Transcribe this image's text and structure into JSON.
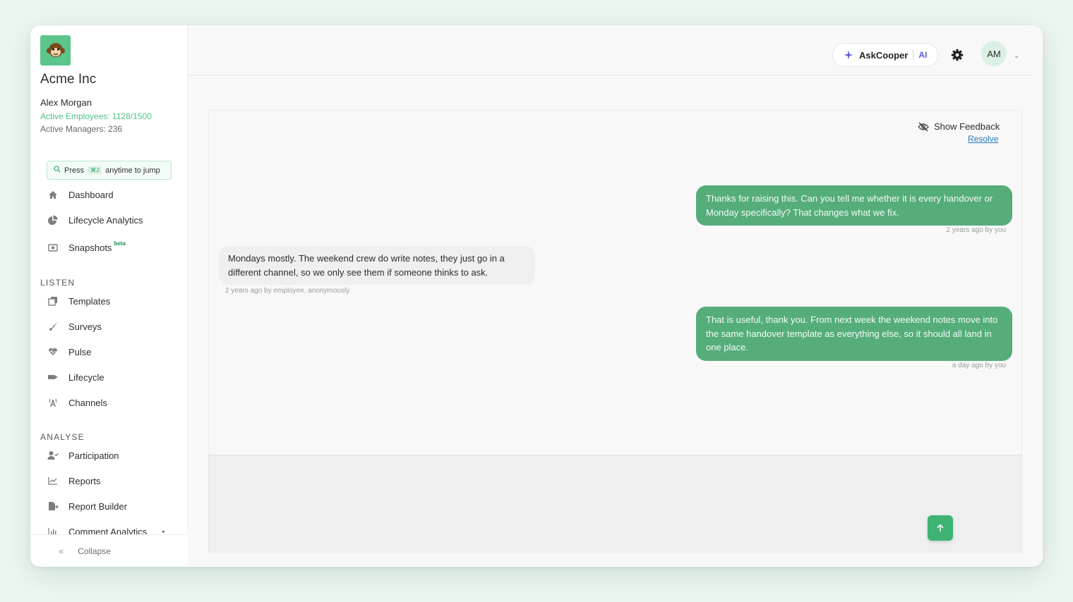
{
  "org": {
    "name": "Acme Inc",
    "user": "Alex Morgan",
    "active_employees": "Active Employees: 1128/1500",
    "active_managers": "Active Managers: 236"
  },
  "jump": {
    "press": "Press",
    "shortcut": "⌘J",
    "suffix": "anytime to jump"
  },
  "nav": {
    "dashboard": "Dashboard",
    "lifecycle_analytics": "Lifecycle Analytics",
    "snapshots": "Snapshots",
    "beta": "beta",
    "listen_label": "LISTEN",
    "templates": "Templates",
    "surveys": "Surveys",
    "pulse": "Pulse",
    "lifecycle": "Lifecycle",
    "channels": "Channels",
    "analyse_label": "ANALYSE",
    "participation": "Participation",
    "reports": "Reports",
    "report_builder": "Report Builder",
    "comment_analytics": "Comment Analytics",
    "collapse": "Collapse"
  },
  "header": {
    "askcooper": "AskCooper",
    "ai": "AI",
    "avatar_initials": "AM"
  },
  "conversation": {
    "show_feedback": "Show Feedback",
    "resolve": "Resolve",
    "messages": [
      {
        "from": "you",
        "text": "Thanks for raising this. Can you tell me whether it is every handover or Monday specifically? That changes what we fix.",
        "meta": "2 years ago by you"
      },
      {
        "from": "employee",
        "text": "Mondays mostly. The weekend crew do write notes, they just go in a different channel, so we only see them if someone thinks to ask.",
        "meta": "2 years ago by employee, anonymously"
      },
      {
        "from": "you",
        "text": "That is useful, thank you. From next week the weekend notes move into the same handover template as everything else, so it should all land in one place.",
        "meta": "a day ago by you"
      }
    ]
  },
  "colors": {
    "brand": "#5cc58c",
    "bubble_you": "#55ad7a",
    "bubble_employee": "#eeefee",
    "link": "#2a7ac0",
    "ai": "#5b5bd6"
  },
  "icons": [
    "monkey-logo-icon",
    "search-icon",
    "home-icon",
    "pie-chart-icon",
    "camera-icon",
    "templates-icon",
    "brush-icon",
    "heartbeat-icon",
    "lifecycle-icon",
    "broadcast-icon",
    "user-check-icon",
    "chart-line-icon",
    "file-export-icon",
    "bar-chart-icon",
    "chevron-double-left-icon",
    "sparkle-icon",
    "gear-icon",
    "chevron-down-icon",
    "eye-slash-icon",
    "arrow-up-icon"
  ]
}
